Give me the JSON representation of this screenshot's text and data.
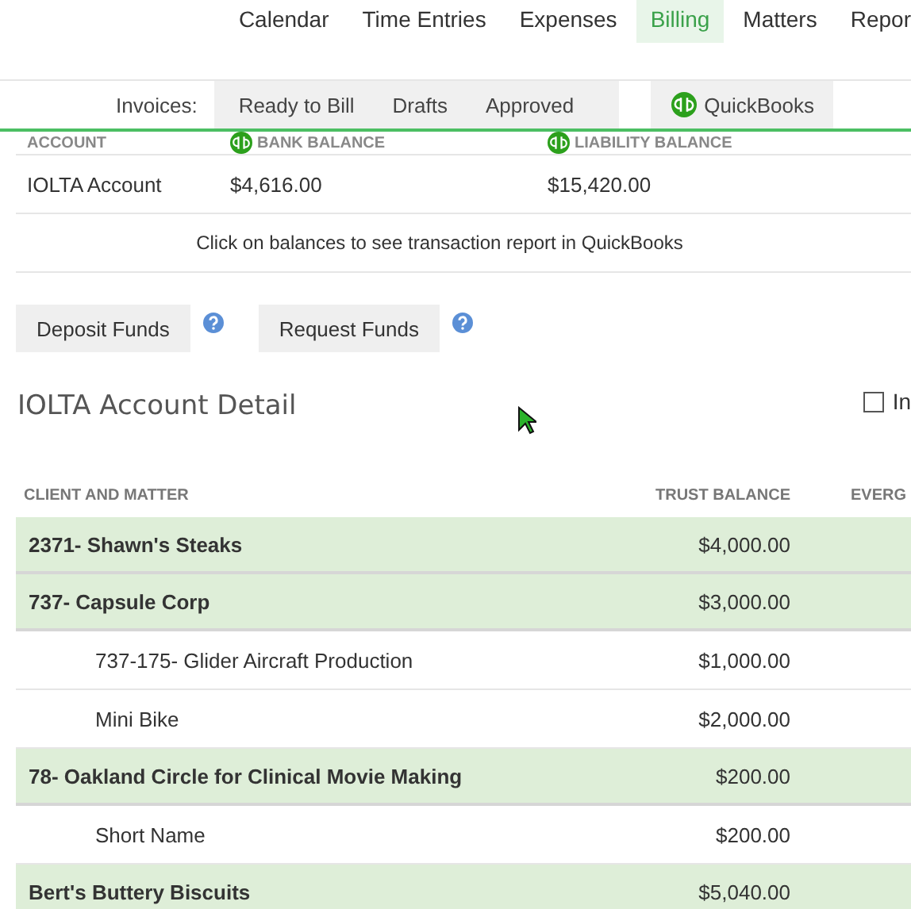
{
  "nav": {
    "items": [
      {
        "label": "Calendar",
        "selected": false
      },
      {
        "label": "Time Entries",
        "selected": false
      },
      {
        "label": "Expenses",
        "selected": false
      },
      {
        "label": "Billing",
        "selected": true
      },
      {
        "label": "Matters",
        "selected": false
      },
      {
        "label": "Repor",
        "selected": false
      }
    ]
  },
  "invoices": {
    "label": "Invoices:",
    "tabs": [
      "Ready to Bill",
      "Drafts",
      "Approved"
    ],
    "quickbooks_button": "QuickBooks"
  },
  "accounts": {
    "columns": [
      {
        "label": "ACCOUNT",
        "kind": "plain"
      },
      {
        "label": "BANK BALANCE",
        "kind": "quickbooks"
      },
      {
        "label": "LIABILITY BALANCE",
        "kind": "quickbooks"
      }
    ],
    "rows": [
      {
        "account": "IOLTA Account",
        "bank_balance": "$4,616.00",
        "liability_balance": "$15,420.00"
      }
    ],
    "note": "Click on balances to see transaction report in QuickBooks"
  },
  "actions": [
    "Deposit Funds",
    "Request Funds"
  ],
  "detail": {
    "title": "IOLTA Account Detail",
    "checkbox": {
      "label": "In",
      "checked": false
    },
    "columns": [
      "CLIENT AND MATTER",
      "TRUST BALANCE",
      "EVERG"
    ],
    "clients": [
      {
        "name": "2371- Shawn's Steaks",
        "trust_balance": "$4,000.00"
      },
      {
        "name": "737- Capsule Corp",
        "trust_balance": "$3,000.00",
        "children": [
          {
            "name": "737-175- Glider Aircraft Production",
            "trust_balance": "$1,000.00"
          },
          {
            "name": "Mini Bike",
            "trust_balance": "$2,000.00"
          }
        ]
      },
      {
        "name": "78- Oakland Circle for Clinical Movie Making",
        "trust_balance": "$200.00",
        "children": [
          {
            "name": "Short Name",
            "trust_balance": "$200.00"
          }
        ]
      },
      {
        "name": "Bert's Buttery Biscuits",
        "trust_balance": "$5,040.00"
      }
    ]
  }
}
